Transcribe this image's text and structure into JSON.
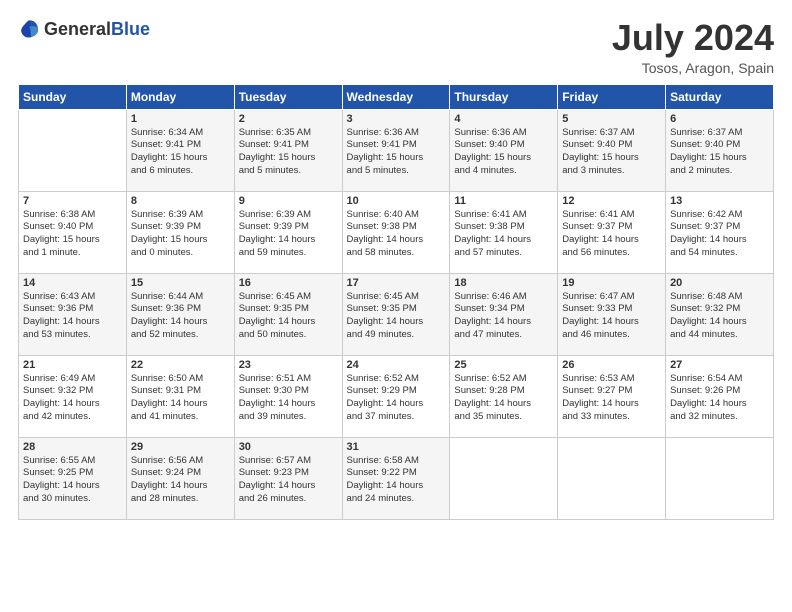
{
  "header": {
    "logo_general": "General",
    "logo_blue": "Blue",
    "month": "July 2024",
    "location": "Tosos, Aragon, Spain"
  },
  "days_of_week": [
    "Sunday",
    "Monday",
    "Tuesday",
    "Wednesday",
    "Thursday",
    "Friday",
    "Saturday"
  ],
  "weeks": [
    [
      {
        "day": "",
        "info": ""
      },
      {
        "day": "1",
        "info": "Sunrise: 6:34 AM\nSunset: 9:41 PM\nDaylight: 15 hours\nand 6 minutes."
      },
      {
        "day": "2",
        "info": "Sunrise: 6:35 AM\nSunset: 9:41 PM\nDaylight: 15 hours\nand 5 minutes."
      },
      {
        "day": "3",
        "info": "Sunrise: 6:36 AM\nSunset: 9:41 PM\nDaylight: 15 hours\nand 5 minutes."
      },
      {
        "day": "4",
        "info": "Sunrise: 6:36 AM\nSunset: 9:40 PM\nDaylight: 15 hours\nand 4 minutes."
      },
      {
        "day": "5",
        "info": "Sunrise: 6:37 AM\nSunset: 9:40 PM\nDaylight: 15 hours\nand 3 minutes."
      },
      {
        "day": "6",
        "info": "Sunrise: 6:37 AM\nSunset: 9:40 PM\nDaylight: 15 hours\nand 2 minutes."
      }
    ],
    [
      {
        "day": "7",
        "info": "Sunrise: 6:38 AM\nSunset: 9:40 PM\nDaylight: 15 hours\nand 1 minute."
      },
      {
        "day": "8",
        "info": "Sunrise: 6:39 AM\nSunset: 9:39 PM\nDaylight: 15 hours\nand 0 minutes."
      },
      {
        "day": "9",
        "info": "Sunrise: 6:39 AM\nSunset: 9:39 PM\nDaylight: 14 hours\nand 59 minutes."
      },
      {
        "day": "10",
        "info": "Sunrise: 6:40 AM\nSunset: 9:38 PM\nDaylight: 14 hours\nand 58 minutes."
      },
      {
        "day": "11",
        "info": "Sunrise: 6:41 AM\nSunset: 9:38 PM\nDaylight: 14 hours\nand 57 minutes."
      },
      {
        "day": "12",
        "info": "Sunrise: 6:41 AM\nSunset: 9:37 PM\nDaylight: 14 hours\nand 56 minutes."
      },
      {
        "day": "13",
        "info": "Sunrise: 6:42 AM\nSunset: 9:37 PM\nDaylight: 14 hours\nand 54 minutes."
      }
    ],
    [
      {
        "day": "14",
        "info": "Sunrise: 6:43 AM\nSunset: 9:36 PM\nDaylight: 14 hours\nand 53 minutes."
      },
      {
        "day": "15",
        "info": "Sunrise: 6:44 AM\nSunset: 9:36 PM\nDaylight: 14 hours\nand 52 minutes."
      },
      {
        "day": "16",
        "info": "Sunrise: 6:45 AM\nSunset: 9:35 PM\nDaylight: 14 hours\nand 50 minutes."
      },
      {
        "day": "17",
        "info": "Sunrise: 6:45 AM\nSunset: 9:35 PM\nDaylight: 14 hours\nand 49 minutes."
      },
      {
        "day": "18",
        "info": "Sunrise: 6:46 AM\nSunset: 9:34 PM\nDaylight: 14 hours\nand 47 minutes."
      },
      {
        "day": "19",
        "info": "Sunrise: 6:47 AM\nSunset: 9:33 PM\nDaylight: 14 hours\nand 46 minutes."
      },
      {
        "day": "20",
        "info": "Sunrise: 6:48 AM\nSunset: 9:32 PM\nDaylight: 14 hours\nand 44 minutes."
      }
    ],
    [
      {
        "day": "21",
        "info": "Sunrise: 6:49 AM\nSunset: 9:32 PM\nDaylight: 14 hours\nand 42 minutes."
      },
      {
        "day": "22",
        "info": "Sunrise: 6:50 AM\nSunset: 9:31 PM\nDaylight: 14 hours\nand 41 minutes."
      },
      {
        "day": "23",
        "info": "Sunrise: 6:51 AM\nSunset: 9:30 PM\nDaylight: 14 hours\nand 39 minutes."
      },
      {
        "day": "24",
        "info": "Sunrise: 6:52 AM\nSunset: 9:29 PM\nDaylight: 14 hours\nand 37 minutes."
      },
      {
        "day": "25",
        "info": "Sunrise: 6:52 AM\nSunset: 9:28 PM\nDaylight: 14 hours\nand 35 minutes."
      },
      {
        "day": "26",
        "info": "Sunrise: 6:53 AM\nSunset: 9:27 PM\nDaylight: 14 hours\nand 33 minutes."
      },
      {
        "day": "27",
        "info": "Sunrise: 6:54 AM\nSunset: 9:26 PM\nDaylight: 14 hours\nand 32 minutes."
      }
    ],
    [
      {
        "day": "28",
        "info": "Sunrise: 6:55 AM\nSunset: 9:25 PM\nDaylight: 14 hours\nand 30 minutes."
      },
      {
        "day": "29",
        "info": "Sunrise: 6:56 AM\nSunset: 9:24 PM\nDaylight: 14 hours\nand 28 minutes."
      },
      {
        "day": "30",
        "info": "Sunrise: 6:57 AM\nSunset: 9:23 PM\nDaylight: 14 hours\nand 26 minutes."
      },
      {
        "day": "31",
        "info": "Sunrise: 6:58 AM\nSunset: 9:22 PM\nDaylight: 14 hours\nand 24 minutes."
      },
      {
        "day": "",
        "info": ""
      },
      {
        "day": "",
        "info": ""
      },
      {
        "day": "",
        "info": ""
      }
    ]
  ]
}
